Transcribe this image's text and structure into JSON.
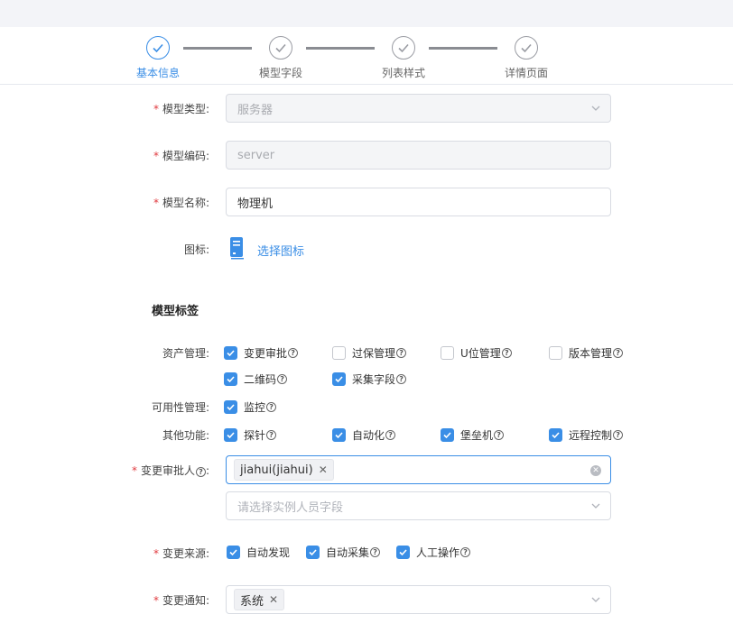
{
  "steps": [
    {
      "label": "基本信息",
      "active": true
    },
    {
      "label": "模型字段",
      "active": false
    },
    {
      "label": "列表样式",
      "active": false
    },
    {
      "label": "详情页面",
      "active": false
    }
  ],
  "form": {
    "model_type": {
      "label": "模型类型:",
      "value": "服务器"
    },
    "model_code": {
      "label": "模型编码:",
      "value": "server"
    },
    "model_name": {
      "label": "模型名称:",
      "value": "物理机"
    },
    "icon": {
      "label": "图标:",
      "link": "选择图标"
    },
    "tags_title": "模型标签",
    "asset_mgmt": {
      "label": "资产管理:",
      "options": [
        {
          "label": "变更审批",
          "checked": true,
          "help": true
        },
        {
          "label": "过保管理",
          "checked": false,
          "help": true
        },
        {
          "label": "U位管理",
          "checked": false,
          "help": true
        },
        {
          "label": "版本管理",
          "checked": false,
          "help": true
        },
        {
          "label": "二维码",
          "checked": true,
          "help": true
        },
        {
          "label": "采集字段",
          "checked": true,
          "help": true
        }
      ]
    },
    "availability": {
      "label": "可用性管理:",
      "options": [
        {
          "label": "监控",
          "checked": true,
          "help": true
        }
      ]
    },
    "other": {
      "label": "其他功能:",
      "options": [
        {
          "label": "探针",
          "checked": true,
          "help": true
        },
        {
          "label": "自动化",
          "checked": true,
          "help": true
        },
        {
          "label": "堡垒机",
          "checked": true,
          "help": true
        },
        {
          "label": "远程控制",
          "checked": true,
          "help": true
        }
      ]
    },
    "approver": {
      "label": "变更审批人",
      "tag": "jiahui(jiahui)",
      "sub_placeholder": "请选择实例人员字段"
    },
    "change_source": {
      "label": "变更来源:",
      "options": [
        {
          "label": "自动发现",
          "checked": true,
          "help": false
        },
        {
          "label": "自动采集",
          "checked": true,
          "help": true
        },
        {
          "label": "人工操作",
          "checked": true,
          "help": true
        }
      ]
    },
    "change_notify": {
      "label": "变更通知:",
      "tag": "系统"
    }
  },
  "colors": {
    "accent": "#3a8ee6",
    "required": "#e0393e"
  }
}
